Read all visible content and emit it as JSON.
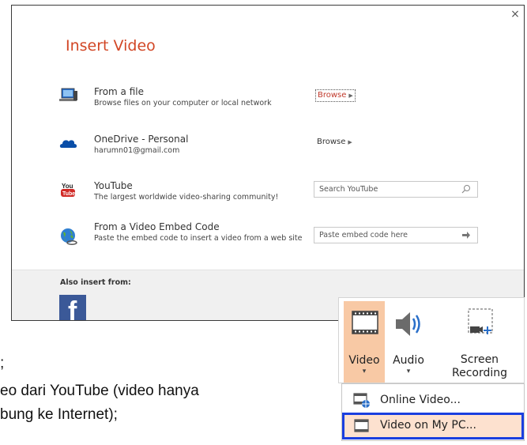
{
  "dialog": {
    "title": "Insert Video",
    "close_label": "×",
    "rows": [
      {
        "title": "From a file",
        "desc": "Browse files on your computer or local network",
        "action": "Browse"
      },
      {
        "title": "OneDrive - Personal",
        "desc": "harumn01@gmail.com",
        "action": "Browse"
      },
      {
        "title": "YouTube",
        "desc": "The largest worldwide video-sharing community!",
        "placeholder": "Search YouTube"
      },
      {
        "title": "From a Video Embed Code",
        "desc": "Paste the embed code to insert a video from a web site",
        "placeholder": "Paste embed code here"
      }
    ],
    "also_label": "Also insert from:",
    "facebook_glyph": "f"
  },
  "background_text": {
    "line1": "eo dari YouTube (video hanya",
    "line2": "bung ke Internet);"
  },
  "ribbon": {
    "video_label": "Video",
    "audio_label": "Audio",
    "screen_label_1": "Screen",
    "screen_label_2": "Recording",
    "dropdown_glyph": "▾"
  },
  "menu": {
    "online_video": "Online Video...",
    "video_on_pc": "Video on My PC..."
  },
  "colors": {
    "title_accent": "#d24726",
    "facebook": "#3b5998",
    "ribbon_highlight": "#f8c9a5",
    "menu_highlight": "#fde1cf",
    "menu_outline": "#1a3fe0"
  }
}
